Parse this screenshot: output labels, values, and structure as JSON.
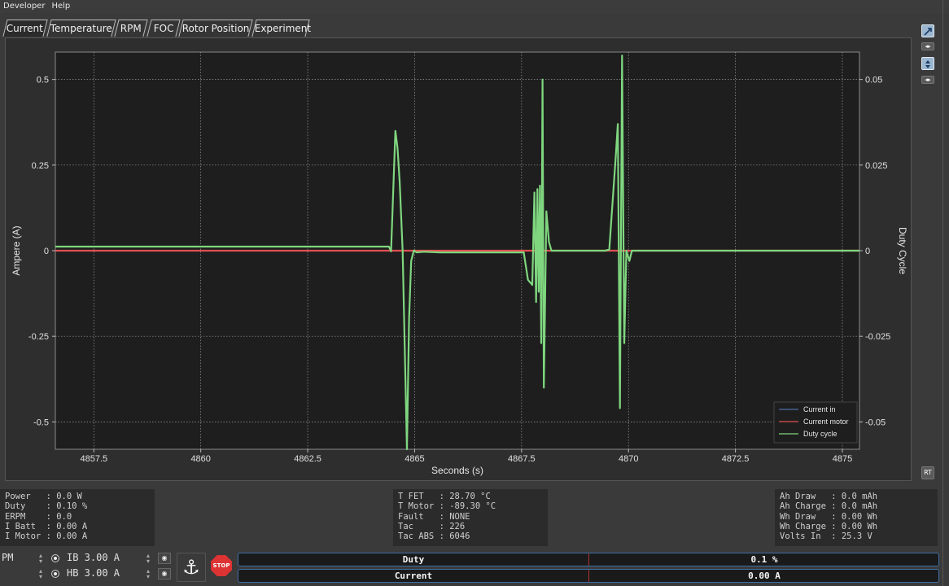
{
  "menu": [
    "Developer",
    "Help"
  ],
  "tabs": [
    "Current",
    "Temperature",
    "RPM",
    "FOC",
    "Rotor Position",
    "Experiment"
  ],
  "active_tab": "Current",
  "chart_data": {
    "type": "line",
    "xlabel": "Seconds (s)",
    "ylabel": "Ampere (A)",
    "y2label": "Duty Cycle",
    "xlim": [
      4856.6,
      4875.4
    ],
    "ylim": [
      -0.58,
      0.58
    ],
    "y2lim": [
      -0.058,
      0.058
    ],
    "x_ticks": [
      4857.5,
      4860,
      4862.5,
      4865,
      4867.5,
      4870,
      4872.5,
      4875
    ],
    "x_tick_labels": [
      "4857.5",
      "4860",
      "4862.5",
      "4865",
      "4867.5",
      "4870",
      "4872.5",
      "4875"
    ],
    "y_ticks": [
      0.5,
      0.25,
      0,
      -0.25,
      -0.5
    ],
    "y_tick_labels": [
      "0.5",
      "0.25",
      "0",
      "-0.25",
      "-0.5"
    ],
    "y2_ticks": [
      0.05,
      0.025,
      0,
      -0.025,
      -0.05
    ],
    "y2_tick_labels": [
      "0.05",
      "0.025",
      "0",
      "-0.025",
      "-0.05"
    ],
    "grid": true,
    "legend_position": "bottom-right",
    "series": [
      {
        "name": "Current in",
        "color": "#4a6fa5",
        "axis": "left",
        "points": [
          [
            4856.6,
            0.0
          ],
          [
            4875.4,
            0.0
          ]
        ]
      },
      {
        "name": "Current motor",
        "color": "#e05050",
        "axis": "left",
        "points": [
          [
            4856.6,
            0.0
          ],
          [
            4875.4,
            0.0
          ]
        ]
      },
      {
        "name": "Duty cycle",
        "color": "#7fd67f",
        "axis": "right",
        "points": [
          [
            4856.6,
            0.0012
          ],
          [
            4857.5,
            0.0012
          ],
          [
            4858.5,
            0.0012
          ],
          [
            4859.5,
            0.0012
          ],
          [
            4860.5,
            0.0012
          ],
          [
            4861.5,
            0.0012
          ],
          [
            4862.5,
            0.0012
          ],
          [
            4863.5,
            0.0012
          ],
          [
            4864.4,
            0.0012
          ],
          [
            4864.45,
            -0.0002
          ],
          [
            4864.55,
            0.035
          ],
          [
            4864.6,
            0.03
          ],
          [
            4864.65,
            0.02
          ],
          [
            4864.72,
            0.0
          ],
          [
            4864.78,
            -0.035
          ],
          [
            4864.82,
            -0.058
          ],
          [
            4864.87,
            -0.02
          ],
          [
            4864.92,
            -0.003
          ],
          [
            4864.98,
            0.0
          ],
          [
            4865.05,
            -0.0005
          ],
          [
            4865.2,
            -0.0003
          ],
          [
            4865.6,
            -0.0005
          ],
          [
            4866.2,
            -0.0005
          ],
          [
            4867.0,
            -0.0005
          ],
          [
            4867.55,
            -0.0005
          ],
          [
            4867.65,
            -0.0085
          ],
          [
            4867.75,
            -0.01
          ],
          [
            4867.8,
            0.017
          ],
          [
            4867.84,
            -0.015
          ],
          [
            4867.87,
            0.018
          ],
          [
            4867.9,
            -0.012
          ],
          [
            4867.93,
            0.019
          ],
          [
            4867.96,
            -0.027
          ],
          [
            4867.99,
            0.05
          ],
          [
            4868.02,
            -0.04
          ],
          [
            4868.08,
            0.0115
          ],
          [
            4868.14,
            0.0025
          ],
          [
            4868.2,
            0.0
          ],
          [
            4868.6,
            0.0
          ],
          [
            4869.2,
            0.0
          ],
          [
            4869.45,
            0.0
          ],
          [
            4869.55,
            0.0003
          ],
          [
            4869.7,
            0.027
          ],
          [
            4869.75,
            0.037
          ],
          [
            4869.8,
            -0.046
          ],
          [
            4869.85,
            0.057
          ],
          [
            4869.9,
            -0.027
          ],
          [
            4869.95,
            0.0
          ],
          [
            4870.02,
            -0.003
          ],
          [
            4870.08,
            0.0
          ],
          [
            4871.0,
            0.0
          ],
          [
            4872.0,
            0.0
          ],
          [
            4873.0,
            0.0
          ],
          [
            4874.0,
            0.0
          ],
          [
            4874.9,
            0.0
          ],
          [
            4875.4,
            0.0
          ]
        ]
      }
    ]
  },
  "status_left": {
    "power": "Power   : 0.0 W",
    "duty": "Duty    : 0.10 %",
    "erpm": "ERPM    : 0.0",
    "ibatt": "I Batt  : 0.00 A",
    "imotor": "I Motor : 0.00 A"
  },
  "status_mid": {
    "tfet": "T FET   : 28.70 °C",
    "tmotor": "T Motor : -89.30 °C",
    "fault": "Fault   : NONE",
    "tac": "Tac     : 226",
    "tacabs": "Tac ABS : 6046"
  },
  "status_right": {
    "ahdraw": "Ah Draw   : 0.0 mAh",
    "ahcharge": "Ah Charge : 0.0 mAh",
    "whdraw": "Wh Draw   : 0.00 Wh",
    "whcharge": "Wh Charge : 0.00 Wh",
    "voltsin": "Volts In  : 25.3 V"
  },
  "controls": {
    "pm_label": "PM",
    "ib_value": "IB 3.00 A",
    "hb_value": "HB 3.00 A",
    "stop_label": "STOP",
    "duty_label": "Duty",
    "duty_value": "0.1 %",
    "current_label": "Current",
    "current_value": "0.00 A",
    "rt_label": "RT"
  }
}
